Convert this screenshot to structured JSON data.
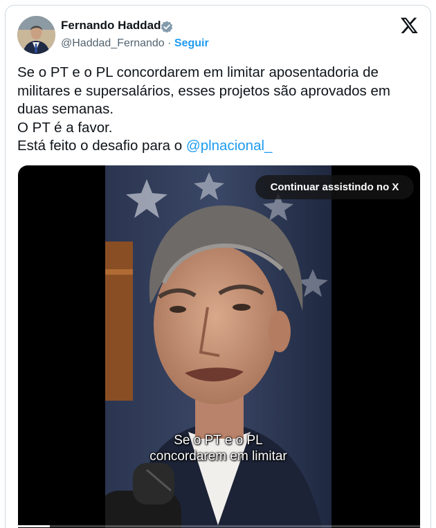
{
  "author": {
    "display_name": "Fernando Haddad",
    "handle": "@Haddad_Fernando",
    "separator": "·",
    "follow_label": "Seguir",
    "avatar_icon": "profile-photo",
    "verified_icon": "verified-badge-icon"
  },
  "platform": {
    "logo_icon": "x-logo-icon"
  },
  "tweet": {
    "lines": [
      "Se o PT e o PL concordarem em limitar aposentadoria de",
      "militares e supersalários, esses projetos são aprovados em",
      "duas semanas.",
      "O PT é a favor.",
      "Está feito o desafio para o "
    ],
    "mention": "@plnacional_"
  },
  "video": {
    "cta_label": "Continuar assistindo no X",
    "caption_line1": "Se o PT e o PL",
    "caption_line2": "concordarem em limitar",
    "progress_fraction": 0.08
  },
  "colors": {
    "link": "#1d9bf0",
    "text": "#0f1419",
    "secondary": "#536471",
    "border": "#cfd9de"
  }
}
